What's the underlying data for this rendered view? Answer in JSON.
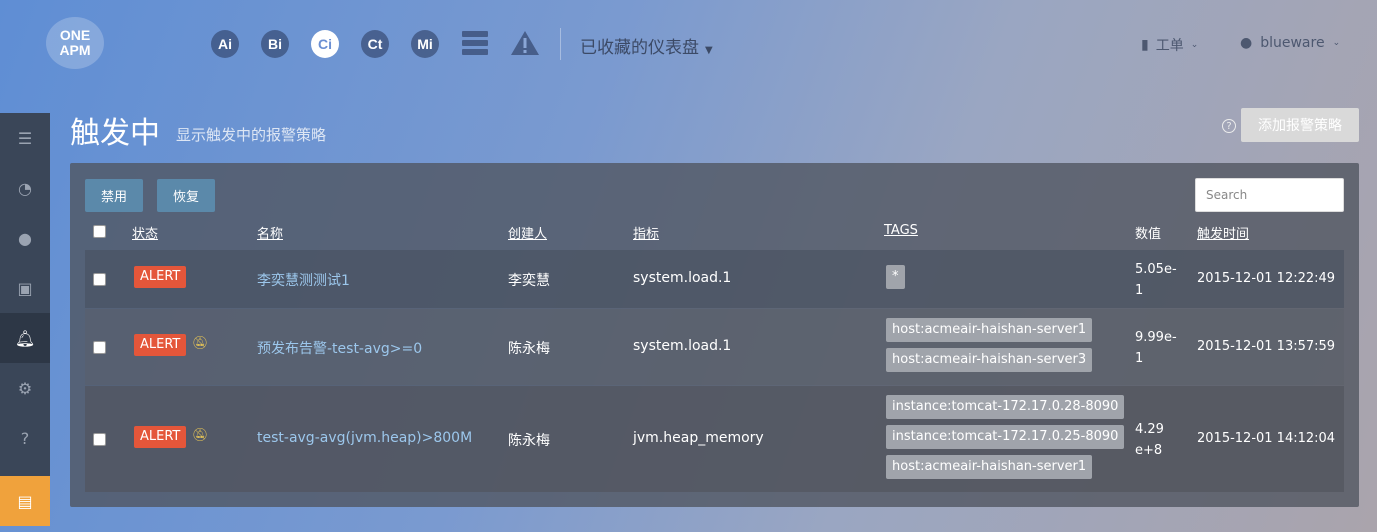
{
  "logo": {
    "line1": "ONE",
    "line2": "APM"
  },
  "nav": {
    "apps": [
      "Ai",
      "Bi",
      "Ci",
      "Ct",
      "Mi"
    ],
    "dashboards_label": "已收藏的仪表盘",
    "tickets_label": "工单",
    "user_label": "blueware"
  },
  "page": {
    "title": "触发中",
    "subtitle": "显示触发中的报警策略",
    "add_button": "添加报警策略"
  },
  "toolbar": {
    "disable_label": "禁用",
    "restore_label": "恢复",
    "search_placeholder": "Search"
  },
  "table": {
    "headers": {
      "status": "状态",
      "name": "名称",
      "creator": "创建人",
      "metric": "指标",
      "tags": "TAGS",
      "value": "数值",
      "time": "触发时间"
    },
    "rows": [
      {
        "status": "ALERT",
        "name": "李奕慧测测试1",
        "creator": "李奕慧",
        "metric": "system.load.1",
        "tags": [
          "*"
        ],
        "value_line1": "5.05e-",
        "value_line2": "1",
        "time": "2015-12-01 12:22:49",
        "muted": false
      },
      {
        "status": "ALERT",
        "name": "预发布告警-test-avg>=0",
        "creator": "陈永梅",
        "metric": "system.load.1",
        "tags": [
          "host:acmeair-haishan-server1",
          "host:acmeair-haishan-server3"
        ],
        "value_line1": "9.99e-",
        "value_line2": "1",
        "time": "2015-12-01 13:57:59",
        "muted": true
      },
      {
        "status": "ALERT",
        "name": "test-avg-avg(jvm.heap)>800M",
        "creator": "陈永梅",
        "metric": "jvm.heap_memory",
        "tags": [
          "instance:tomcat-172.17.0.28-8090",
          "instance:tomcat-172.17.0.25-8090",
          "host:acmeair-haishan-server1"
        ],
        "value_line1": "4.29",
        "value_line2": "e+8",
        "time": "2015-12-01 14:12:04",
        "muted": true
      }
    ]
  },
  "colors": {
    "alert": "#e4563a",
    "link": "#9cc7ec",
    "primary_button": "#5b89aa",
    "sidebar": "#3a4658",
    "sidebar_accent": "#f0a23c"
  }
}
